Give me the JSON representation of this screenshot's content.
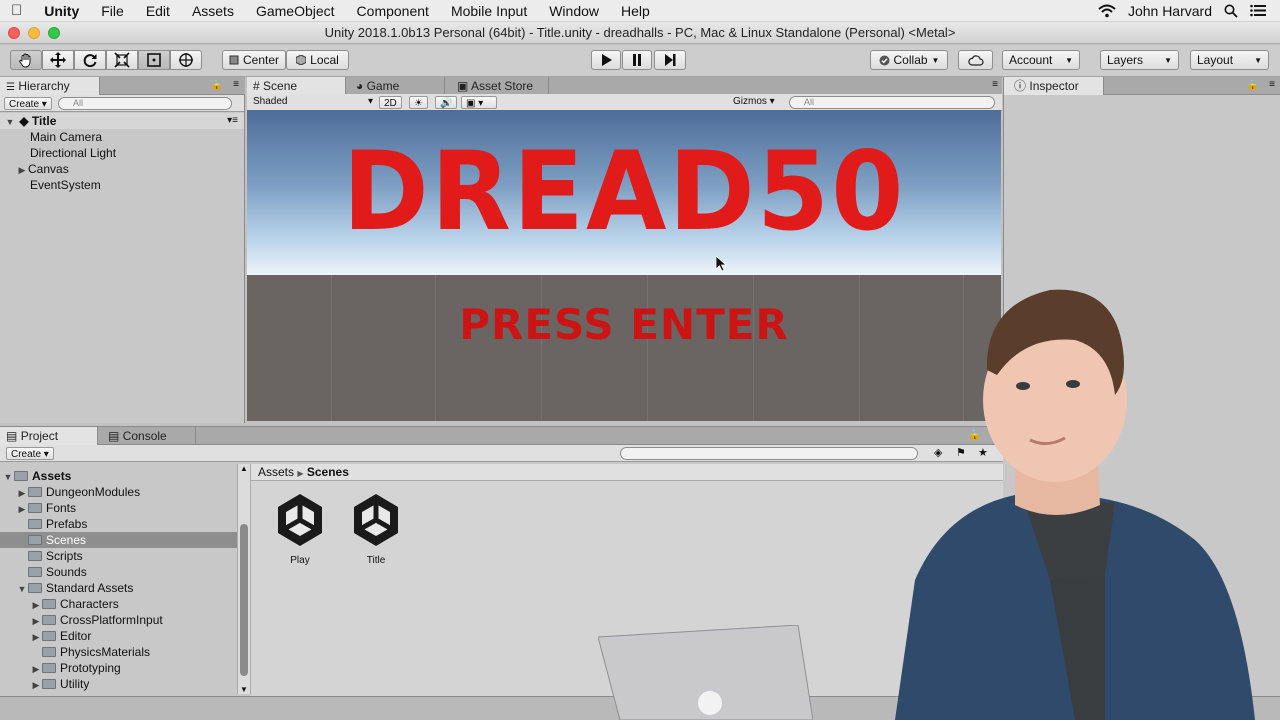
{
  "menubar": {
    "app": "Unity",
    "items": [
      "File",
      "Edit",
      "Assets",
      "GameObject",
      "Component",
      "Mobile Input",
      "Window",
      "Help"
    ],
    "user": "John Harvard"
  },
  "window_title": "Unity 2018.1.0b13 Personal (64bit) - Title.unity - dreadhalls - PC, Mac & Linux Standalone (Personal) <Metal>",
  "toolbar": {
    "pivot": "Center",
    "space": "Local",
    "collab": "Collab",
    "account": "Account",
    "layers": "Layers",
    "layout": "Layout"
  },
  "hierarchy": {
    "tab": "Hierarchy",
    "create": "Create",
    "search_placeholder": "All",
    "scene": "Title",
    "items": [
      "Main Camera",
      "Directional Light",
      "Canvas",
      "EventSystem"
    ]
  },
  "center_tabs": [
    "Scene",
    "Game",
    "Asset Store"
  ],
  "scene_bar": {
    "shading": "Shaded",
    "mode2d": "2D",
    "gizmos": "Gizmos",
    "search_placeholder": "All"
  },
  "scene_content": {
    "title": "DREAD50",
    "subtitle": "PRESS ENTER"
  },
  "inspector": {
    "tab": "Inspector"
  },
  "bottom_tabs": [
    "Project",
    "Console"
  ],
  "project": {
    "create": "Create",
    "tree": [
      {
        "label": "Assets",
        "depth": 0,
        "expanded": true,
        "bold": true
      },
      {
        "label": "DungeonModules",
        "depth": 1,
        "arrow": true
      },
      {
        "label": "Fonts",
        "depth": 1,
        "arrow": true
      },
      {
        "label": "Prefabs",
        "depth": 1,
        "arrow": false
      },
      {
        "label": "Scenes",
        "depth": 1,
        "arrow": false,
        "selected": true
      },
      {
        "label": "Scripts",
        "depth": 1,
        "arrow": false
      },
      {
        "label": "Sounds",
        "depth": 1,
        "arrow": false
      },
      {
        "label": "Standard Assets",
        "depth": 1,
        "expanded": true
      },
      {
        "label": "Characters",
        "depth": 2,
        "arrow": true
      },
      {
        "label": "CrossPlatformInput",
        "depth": 2,
        "arrow": true
      },
      {
        "label": "Editor",
        "depth": 2,
        "arrow": true
      },
      {
        "label": "PhysicsMaterials",
        "depth": 2,
        "arrow": false
      },
      {
        "label": "Prototyping",
        "depth": 2,
        "arrow": true
      },
      {
        "label": "Utility",
        "depth": 2,
        "arrow": true
      }
    ],
    "breadcrumb": [
      "Assets",
      "Scenes"
    ],
    "assets": [
      "Play",
      "Title"
    ]
  },
  "colors": {
    "title_red": "#e11a1a",
    "selection": "#8e8e8e"
  }
}
